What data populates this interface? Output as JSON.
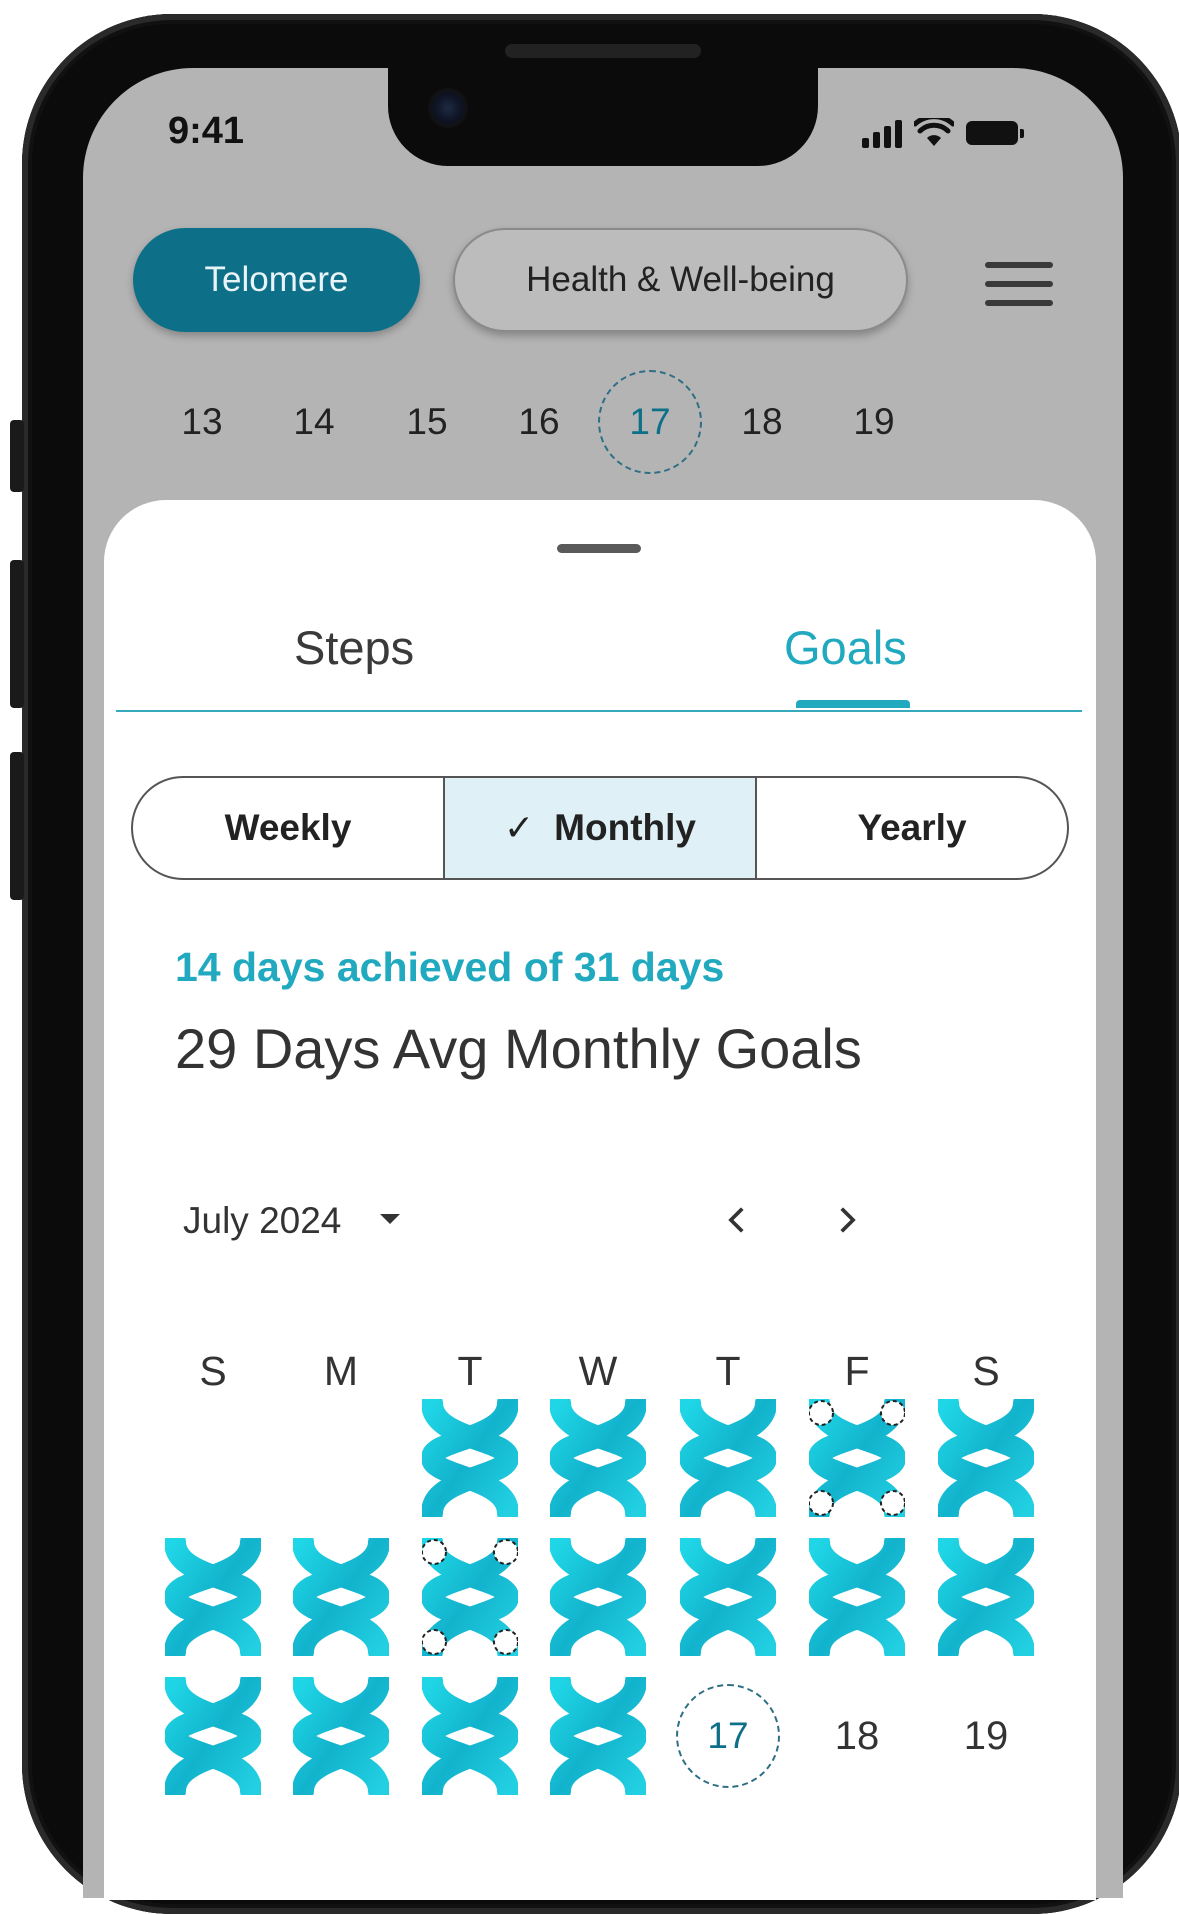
{
  "status_bar": {
    "time": "9:41"
  },
  "header": {
    "chips": [
      {
        "label": "Telomere",
        "active": true
      },
      {
        "label": "Health & Well-being",
        "active": false
      }
    ],
    "menu_icon": "hamburger-menu-icon"
  },
  "week_strip": {
    "days": [
      "13",
      "14",
      "15",
      "16",
      "17",
      "18",
      "19"
    ],
    "selected": "17"
  },
  "tabs": [
    {
      "label": "Steps",
      "active": false
    },
    {
      "label": "Goals",
      "active": true
    }
  ],
  "period_selector": {
    "options": [
      "Weekly",
      "Monthly",
      "Yearly"
    ],
    "selected": "Monthly",
    "check_icon": "checkmark-icon"
  },
  "summary": {
    "achieved": "14 days achieved of 31 days",
    "average": "29 Days Avg Monthly Goals"
  },
  "calendar": {
    "month_label": "July 2024",
    "weekdays": [
      "S",
      "M",
      "T",
      "W",
      "T",
      "F",
      "S"
    ],
    "rows": [
      [
        "",
        "",
        "goal",
        "goal",
        "goal",
        "goal-partial",
        "goal"
      ],
      [
        "goal",
        "goal",
        "goal-partial",
        "goal",
        "goal",
        "goal",
        "goal"
      ],
      [
        "goal",
        "goal",
        "goal",
        "goal",
        "17",
        "18",
        "19"
      ]
    ],
    "selected_day": "17",
    "goal_icon": "telomere-x-icon",
    "accent": "#1fc3d6"
  },
  "colors": {
    "primary": "#0e7088",
    "accent": "#20a9bf",
    "screen_bg": "#b4b4b4"
  }
}
